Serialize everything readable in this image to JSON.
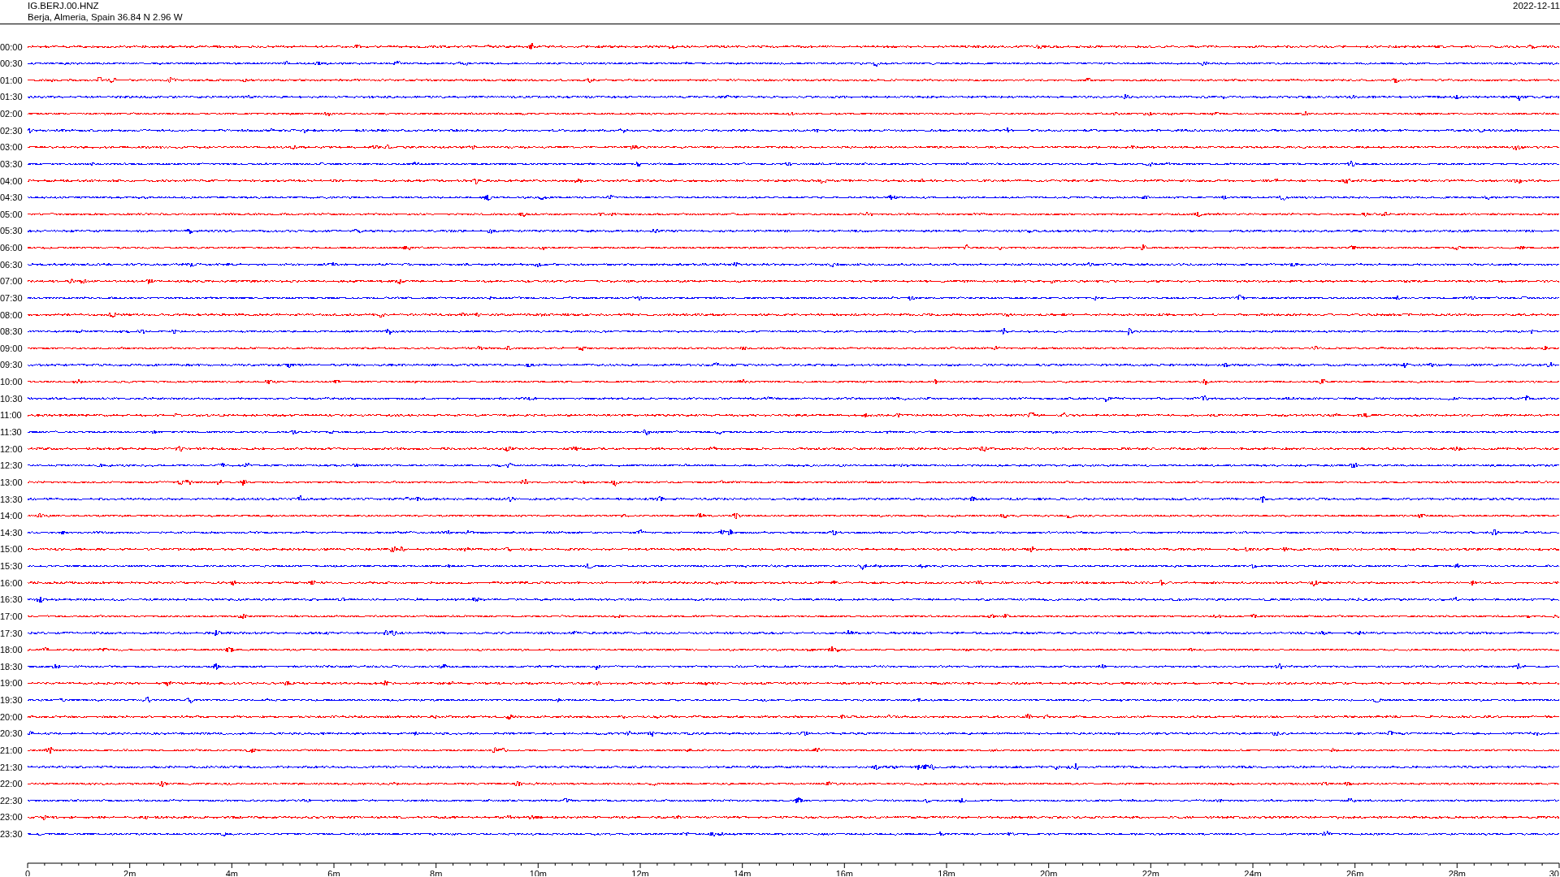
{
  "header": {
    "station": "IG.BERJ.00.HNZ",
    "location": "Berja, Almeria, Spain  36.84 N 2.96 W",
    "date": "2022-12-11"
  },
  "rows": [
    {
      "label": "00:00",
      "color": "#ff0000"
    },
    {
      "label": "00:30",
      "color": "#0000ff"
    },
    {
      "label": "01:00",
      "color": "#ff0000"
    },
    {
      "label": "01:30",
      "color": "#0000ff"
    },
    {
      "label": "02:00",
      "color": "#ff0000"
    },
    {
      "label": "02:30",
      "color": "#0000ff"
    },
    {
      "label": "03:00",
      "color": "#ff0000"
    },
    {
      "label": "03:30",
      "color": "#0000ff"
    },
    {
      "label": "04:00",
      "color": "#ff0000"
    },
    {
      "label": "04:30",
      "color": "#0000ff"
    },
    {
      "label": "05:00",
      "color": "#ff0000"
    },
    {
      "label": "05:30",
      "color": "#0000ff"
    },
    {
      "label": "06:00",
      "color": "#ff0000"
    },
    {
      "label": "06:30",
      "color": "#0000ff"
    },
    {
      "label": "07:00",
      "color": "#ff0000"
    },
    {
      "label": "07:30",
      "color": "#0000ff"
    },
    {
      "label": "08:00",
      "color": "#ff0000"
    },
    {
      "label": "08:30",
      "color": "#0000ff"
    },
    {
      "label": "09:00",
      "color": "#ff0000"
    },
    {
      "label": "09:30",
      "color": "#0000ff"
    },
    {
      "label": "10:00",
      "color": "#ff0000"
    },
    {
      "label": "10:30",
      "color": "#0000ff"
    },
    {
      "label": "11:00",
      "color": "#ff0000"
    },
    {
      "label": "11:30",
      "color": "#0000ff"
    },
    {
      "label": "12:00",
      "color": "#ff0000"
    },
    {
      "label": "12:30",
      "color": "#0000ff"
    },
    {
      "label": "13:00",
      "color": "#ff0000"
    },
    {
      "label": "13:30",
      "color": "#0000ff"
    },
    {
      "label": "14:00",
      "color": "#ff0000"
    },
    {
      "label": "14:30",
      "color": "#0000ff"
    },
    {
      "label": "15:00",
      "color": "#ff0000"
    },
    {
      "label": "15:30",
      "color": "#0000ff"
    },
    {
      "label": "16:00",
      "color": "#ff0000"
    },
    {
      "label": "16:30",
      "color": "#0000ff"
    },
    {
      "label": "17:00",
      "color": "#ff0000"
    },
    {
      "label": "17:30",
      "color": "#0000ff"
    },
    {
      "label": "18:00",
      "color": "#ff0000"
    },
    {
      "label": "18:30",
      "color": "#0000ff"
    },
    {
      "label": "19:00",
      "color": "#ff0000"
    },
    {
      "label": "19:30",
      "color": "#0000ff"
    },
    {
      "label": "20:00",
      "color": "#ff0000"
    },
    {
      "label": "20:30",
      "color": "#0000ff"
    },
    {
      "label": "21:00",
      "color": "#ff0000"
    },
    {
      "label": "21:30",
      "color": "#0000ff"
    },
    {
      "label": "22:00",
      "color": "#ff0000"
    },
    {
      "label": "22:30",
      "color": "#0000ff"
    },
    {
      "label": "23:00",
      "color": "#ff0000"
    },
    {
      "label": "23:30",
      "color": "#0000ff"
    }
  ],
  "x_axis": {
    "tick_labels": [
      "0",
      "2m",
      "4m",
      "6m",
      "8m",
      "10m",
      "12m",
      "14m",
      "16m",
      "18m",
      "20m",
      "22m",
      "24m",
      "26m",
      "28m",
      "30"
    ]
  }
}
